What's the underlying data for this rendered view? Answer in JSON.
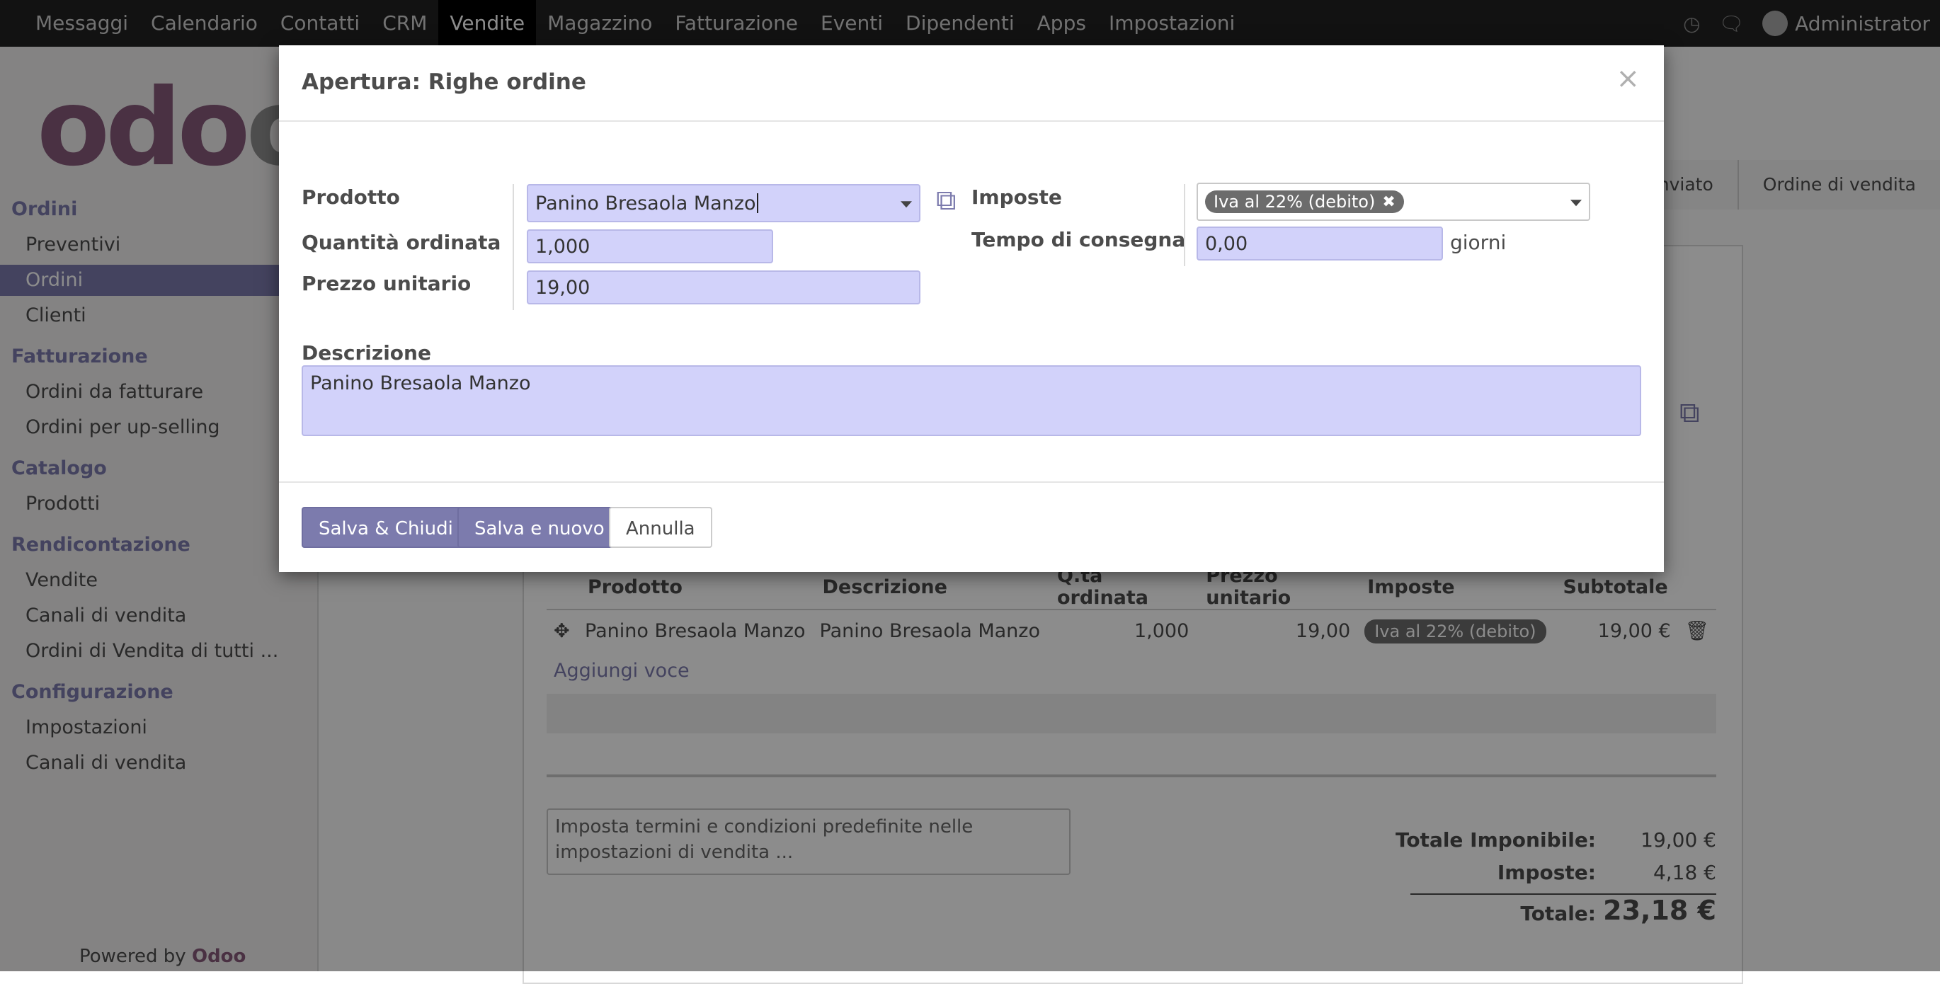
{
  "topbar": {
    "menu": [
      "Messaggi",
      "Calendario",
      "Contatti",
      "CRM",
      "Vendite",
      "Magazzino",
      "Fatturazione",
      "Eventi",
      "Dipendenti",
      "Apps",
      "Impostazioni"
    ],
    "active": "Vendite",
    "user": "Administrator"
  },
  "sidebar": {
    "sections": [
      {
        "title": "Ordini",
        "items": [
          "Preventivi",
          "Ordini",
          "Clienti"
        ]
      },
      {
        "title": "Fatturazione",
        "items": [
          "Ordini da fatturare",
          "Ordini per up-selling"
        ]
      },
      {
        "title": "Catalogo",
        "items": [
          "Prodotti"
        ]
      },
      {
        "title": "Rendicontazione",
        "items": [
          "Vendite",
          "Canali di vendita",
          "Ordini di Vendita di tutti ..."
        ]
      },
      {
        "title": "Configurazione",
        "items": [
          "Impostazioni",
          "Canali di vendita"
        ]
      }
    ],
    "active_item": "Ordini",
    "powered_prefix": "Powered by",
    "powered_brand": "Odoo"
  },
  "background": {
    "status_steps": [
      "o inviato",
      "Ordine di vendita"
    ],
    "table": {
      "headers": [
        "Prodotto",
        "Descrizione",
        "Q.tà ordinata",
        "Prezzo unitario",
        "Imposte",
        "Subtotale"
      ],
      "row": {
        "prodotto": "Panino Bresaola Manzo",
        "descrizione": "Panino Bresaola Manzo",
        "qta": "1,000",
        "prezzo": "19,00",
        "imposte": "Iva al 22% (debito)",
        "subtotale": "19,00 €"
      }
    },
    "add_line": "Aggiungi voce",
    "terms_placeholder": "Imposta termini e condizioni predefinite nelle impostazioni di vendita ...",
    "totals": {
      "imponibile_label": "Totale Imponibile:",
      "imponibile": "19,00 €",
      "imposte_label": "Imposte:",
      "imposte": "4,18 €",
      "totale_label": "Totale:",
      "totale": "23,18 €"
    }
  },
  "modal": {
    "title": "Apertura: Righe ordine",
    "close": "×",
    "fields": {
      "prodotto_label": "Prodotto",
      "prodotto": "Panino Bresaola Manzo",
      "quantita_label": "Quantità ordinata",
      "quantita": "1,000",
      "prezzo_label": "Prezzo unitario",
      "prezzo": "19,00",
      "imposte_label": "Imposte",
      "imposte_tag": "Iva al 22% (debito)",
      "consegna_label": "Tempo di consegna",
      "consegna": "0,00",
      "consegna_unit": "giorni",
      "descrizione_label": "Descrizione",
      "descrizione": "Panino Bresaola Manzo"
    },
    "buttons": {
      "save_close": "Salva & Chiudi",
      "save_new": "Salva e nuovo",
      "cancel": "Annulla"
    }
  },
  "colors": {
    "brand": "#875a7b",
    "accent": "#7c7bad",
    "input_bg": "#d2d2fa"
  }
}
